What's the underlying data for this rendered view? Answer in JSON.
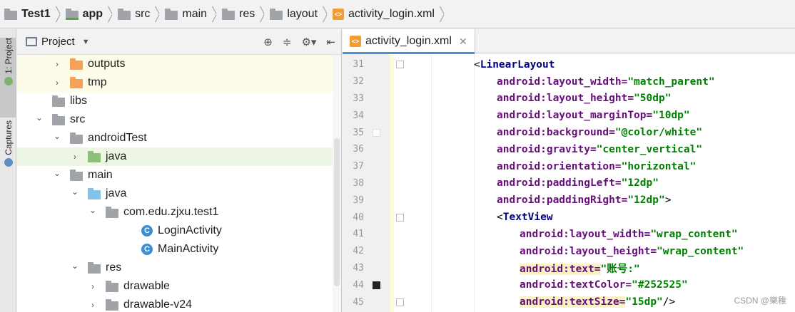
{
  "breadcrumb": [
    {
      "label": "Test1",
      "icon": "project-folder-icon",
      "bold": true
    },
    {
      "label": "app",
      "icon": "module-folder-icon",
      "bold": true
    },
    {
      "label": "src",
      "icon": "folder-icon",
      "bold": false
    },
    {
      "label": "main",
      "icon": "folder-icon",
      "bold": false
    },
    {
      "label": "res",
      "icon": "resource-folder-icon",
      "bold": false
    },
    {
      "label": "layout",
      "icon": "folder-icon",
      "bold": false
    },
    {
      "label": "activity_login.xml",
      "icon": "xml-file-icon",
      "bold": false
    }
  ],
  "toolstrip": {
    "project_tab": "1: Project",
    "captures_tab": "Captures"
  },
  "project_panel": {
    "title": "Project",
    "tree": [
      {
        "label": "outputs",
        "depth": 3,
        "arrow": "›",
        "icon": "orange",
        "state": "highlight"
      },
      {
        "label": "tmp",
        "depth": 3,
        "arrow": "›",
        "icon": "orange",
        "state": "highlight"
      },
      {
        "label": "libs",
        "depth": 2,
        "arrow": "",
        "icon": "grey",
        "state": ""
      },
      {
        "label": "src",
        "depth": 2,
        "arrow": "⌄",
        "icon": "grey",
        "state": ""
      },
      {
        "label": "androidTest",
        "depth": 3,
        "arrow": "⌄",
        "icon": "grey",
        "state": ""
      },
      {
        "label": "java",
        "depth": 4,
        "arrow": "›",
        "icon": "green",
        "state": "selected"
      },
      {
        "label": "main",
        "depth": 3,
        "arrow": "⌄",
        "icon": "grey",
        "state": ""
      },
      {
        "label": "java",
        "depth": 4,
        "arrow": "⌄",
        "icon": "blue",
        "state": ""
      },
      {
        "label": "com.edu.zjxu.test1",
        "depth": 5,
        "arrow": "⌄",
        "icon": "grey",
        "state": ""
      },
      {
        "label": "LoginActivity",
        "depth": 7,
        "arrow": "",
        "icon": "class",
        "state": ""
      },
      {
        "label": "MainActivity",
        "depth": 7,
        "arrow": "",
        "icon": "class",
        "state": ""
      },
      {
        "label": "res",
        "depth": 4,
        "arrow": "⌄",
        "icon": "res",
        "state": ""
      },
      {
        "label": "drawable",
        "depth": 5,
        "arrow": "›",
        "icon": "grey",
        "state": ""
      },
      {
        "label": "drawable-v24",
        "depth": 5,
        "arrow": "›",
        "icon": "grey",
        "state": ""
      }
    ]
  },
  "editor": {
    "tab_label": "activity_login.xml",
    "lines": [
      {
        "num": "31",
        "indent": 5,
        "parts": [
          [
            "bracket",
            "<"
          ],
          [
            "tag",
            "LinearLayout"
          ]
        ],
        "mark": "",
        "fold": true
      },
      {
        "num": "32",
        "indent": 6,
        "parts": [
          [
            "attr",
            "android:layout_width="
          ],
          [
            "val",
            "\"match_parent\""
          ]
        ],
        "mark": "",
        "fold": false
      },
      {
        "num": "33",
        "indent": 6,
        "parts": [
          [
            "attr",
            "android:layout_height="
          ],
          [
            "val",
            "\"50dp\""
          ]
        ],
        "mark": "",
        "fold": false
      },
      {
        "num": "34",
        "indent": 6,
        "parts": [
          [
            "attr",
            "android:layout_marginTop="
          ],
          [
            "val",
            "\"10dp\""
          ]
        ],
        "mark": "",
        "fold": false
      },
      {
        "num": "35",
        "indent": 6,
        "parts": [
          [
            "attr",
            "android:background="
          ],
          [
            "val",
            "\"@color/white\""
          ]
        ],
        "mark": "white",
        "fold": false
      },
      {
        "num": "36",
        "indent": 6,
        "parts": [
          [
            "attr",
            "android:gravity="
          ],
          [
            "val",
            "\"center_vertical\""
          ]
        ],
        "mark": "",
        "fold": false
      },
      {
        "num": "37",
        "indent": 6,
        "parts": [
          [
            "attr",
            "android:orientation="
          ],
          [
            "val",
            "\"horizontal\""
          ]
        ],
        "mark": "",
        "fold": false
      },
      {
        "num": "38",
        "indent": 6,
        "parts": [
          [
            "attr",
            "android:paddingLeft="
          ],
          [
            "val",
            "\"12dp\""
          ]
        ],
        "mark": "",
        "fold": false
      },
      {
        "num": "39",
        "indent": 6,
        "parts": [
          [
            "attr",
            "android:paddingRight="
          ],
          [
            "val",
            "\"12dp\""
          ],
          [
            "bracket",
            ">"
          ]
        ],
        "mark": "",
        "fold": false
      },
      {
        "num": "40",
        "indent": 6,
        "parts": [
          [
            "bracket",
            "<"
          ],
          [
            "tag",
            "TextView"
          ]
        ],
        "mark": "",
        "fold": true
      },
      {
        "num": "41",
        "indent": 7,
        "parts": [
          [
            "attr",
            "android:layout_width="
          ],
          [
            "val",
            "\"wrap_content\""
          ]
        ],
        "mark": "",
        "fold": false
      },
      {
        "num": "42",
        "indent": 7,
        "parts": [
          [
            "attr",
            "android:layout_height="
          ],
          [
            "val",
            "\"wrap_content\""
          ]
        ],
        "mark": "",
        "fold": false
      },
      {
        "num": "43",
        "indent": 7,
        "parts": [
          [
            "attr hl",
            "android:text="
          ],
          [
            "val",
            "\"账号:\""
          ]
        ],
        "mark": "",
        "fold": false
      },
      {
        "num": "44",
        "indent": 7,
        "parts": [
          [
            "attr",
            "android:textColor="
          ],
          [
            "val",
            "\"#252525\""
          ]
        ],
        "mark": "black",
        "fold": false
      },
      {
        "num": "45",
        "indent": 7,
        "parts": [
          [
            "attr hl",
            "android:textSize="
          ],
          [
            "val",
            "\"15dp\""
          ],
          [
            "bracket",
            "/>"
          ]
        ],
        "mark": "",
        "fold": true
      }
    ]
  },
  "watermark": "CSDN @樂稚"
}
